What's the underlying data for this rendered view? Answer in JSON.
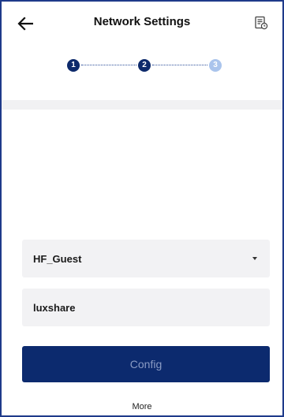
{
  "header": {
    "title": "Network Settings",
    "back_icon": "arrow-left-icon",
    "log_icon": "document-clock-icon"
  },
  "stepper": {
    "steps": [
      "1",
      "2",
      "3"
    ],
    "current": 2,
    "colors": {
      "done": "#0d2a6b",
      "pending": "#aac4ec"
    }
  },
  "form": {
    "ssid_value": "HF_Guest",
    "password_value": "luxshare",
    "dropdown_icon": "caret-down-icon"
  },
  "actions": {
    "config_label": "Config",
    "more_label": "More"
  },
  "theme": {
    "primary": "#0c2a6e",
    "field_bg": "#f2f2f4"
  }
}
